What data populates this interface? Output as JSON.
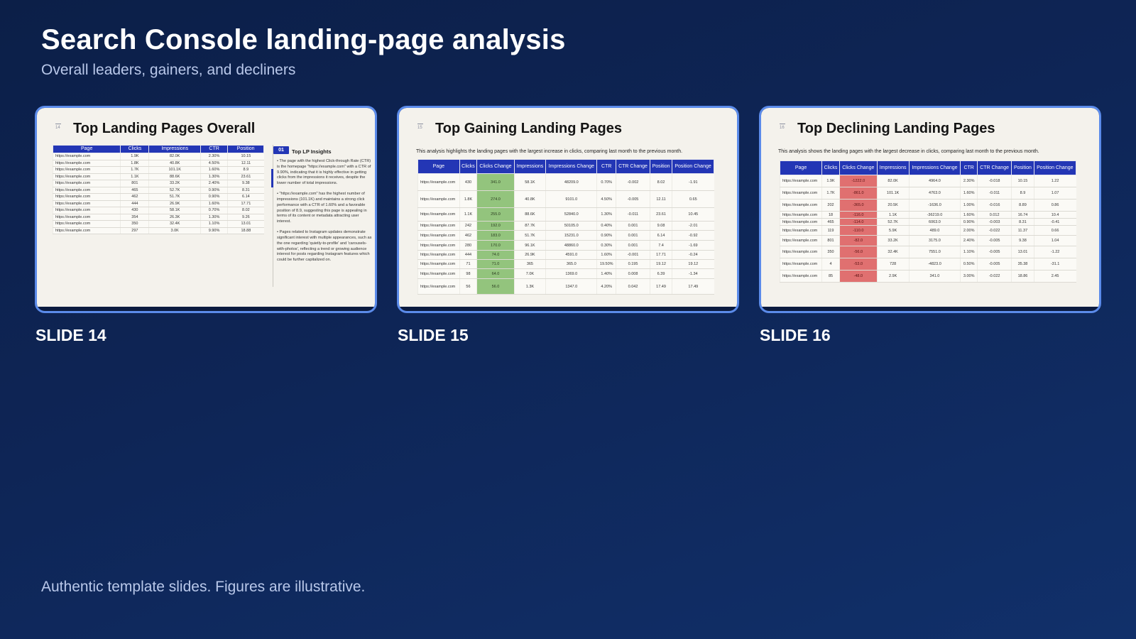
{
  "header": {
    "title": "Search Console landing-page analysis",
    "subtitle": "Overall leaders, gainers, and decliners"
  },
  "footer": {
    "note": "Authentic template slides. Figures are illustrative."
  },
  "colors": {
    "accent": "#2336b5",
    "card_border": "#5b8bea",
    "gain": "#93c47d",
    "loss": "#e07070"
  },
  "slides": [
    {
      "label": "SLIDE 14",
      "number": "14",
      "title": "Top Landing Pages Overall",
      "table": {
        "headers": [
          "Page",
          "Clicks",
          "Impressions",
          "CTR",
          "Position"
        ],
        "rows": [
          [
            "https://example.com",
            "1.9K",
            "82.0K",
            "2.30%",
            "10.15"
          ],
          [
            "https://example.com",
            "1.8K",
            "40.8K",
            "4.50%",
            "12.11"
          ],
          [
            "https://example.com",
            "1.7K",
            "101.1K",
            "1.60%",
            "8.9"
          ],
          [
            "https://example.com",
            "1.1K",
            "88.6K",
            "1.30%",
            "23.61"
          ],
          [
            "https://example.com",
            "801",
            "33.2K",
            "2.40%",
            "9.38"
          ],
          [
            "https://example.com",
            "465",
            "52.7K",
            "0.90%",
            "8.31"
          ],
          [
            "https://example.com",
            "462",
            "51.7K",
            "0.90%",
            "6.14"
          ],
          [
            "https://example.com",
            "444",
            "26.9K",
            "1.60%",
            "17.71"
          ],
          [
            "https://example.com",
            "430",
            "58.1K",
            "0.70%",
            "8.02"
          ],
          [
            "https://example.com",
            "354",
            "26.3K",
            "1.30%",
            "9.26"
          ],
          [
            "https://example.com",
            "350",
            "32.4K",
            "1.10%",
            "13.01"
          ],
          [
            "https://example.com",
            "297",
            "3.0K",
            "9.90%",
            "18.88"
          ]
        ]
      },
      "insights": {
        "badge": "01",
        "title": "Top LP Insights",
        "paragraphs": [
          "• The page with the highest Click-through Rate (CTR) is the homepage \"https://example.com\" with a CTR of 9.90%, indicating that it is highly effective in getting clicks from the impressions it receives, despite the lower number of total impressions.",
          "• \"https://example.com\" has the highest number of impressions (101.1K) and maintains a strong click performance with a CTR of 1.60% and a favorable position of 8.9, suggesting this page is appealing in terms of its content or metadata attracting user interest.",
          "• Pages related to Instagram updates demonstrate significant interest with multiple appearances, such as the one regarding 'quietly-to-profile' and 'carousels-with-photos', reflecting a trend or growing audience interest for posts regarding Instagram features which could be further capitalized on."
        ]
      }
    },
    {
      "label": "SLIDE 15",
      "number": "15",
      "title": "Top Gaining Landing Pages",
      "description": "This analysis highlights the landing pages with the largest increase in clicks, comparing last month to the previous month.",
      "table": {
        "headers": [
          "Page",
          "Clicks",
          "Clicks Change",
          "Impressions",
          "Impressions Change",
          "CTR",
          "CTR Change",
          "Position",
          "Position Change"
        ],
        "rows": [
          [
            "https://example.com",
            "430",
            "341.0",
            "58.1K",
            "48209.0",
            "0.70%",
            "-0.002",
            "8.02",
            "-1.91"
          ],
          [
            "https://example.com",
            "1.8K",
            "274.0",
            "40.8K",
            "9101.0",
            "4.50%",
            "-0.005",
            "12.11",
            "0.65"
          ],
          [
            "https://example.com",
            "1.1K",
            "255.0",
            "88.6K",
            "52840.0",
            "1.30%",
            "-0.011",
            "23.61",
            "10.45"
          ],
          [
            "https://example.com",
            "242",
            "192.0",
            "87.7K",
            "50105.0",
            "0.40%",
            "0.001",
            "9.08",
            "-2.01"
          ],
          [
            "https://example.com",
            "462",
            "183.0",
            "51.7K",
            "15231.0",
            "0.90%",
            "0.001",
            "6.14",
            "-0.92"
          ],
          [
            "https://example.com",
            "280",
            "170.0",
            "96.1K",
            "48860.0",
            "0.30%",
            "0.001",
            "7.4",
            "-1.69"
          ],
          [
            "https://example.com",
            "444",
            "74.0",
            "26.9K",
            "4591.0",
            "1.60%",
            "-0.001",
            "17.71",
            "-0.24"
          ],
          [
            "https://example.com",
            "71",
            "71.0",
            "365",
            "365.0",
            "19.50%",
            "0.195",
            "19.12",
            "19.12"
          ],
          [
            "https://example.com",
            "98",
            "64.0",
            "7.0K",
            "1369.0",
            "1.40%",
            "0.008",
            "6.39",
            "-1.34"
          ],
          [
            "https://example.com",
            "56",
            "56.0",
            "1.3K",
            "1347.0",
            "4.20%",
            "0.042",
            "17.49",
            "17.49"
          ]
        ]
      }
    },
    {
      "label": "SLIDE 16",
      "number": "16",
      "title": "Top Declining Landing Pages",
      "description": "This analysis shows the landing pages with the largest decrease in clicks, comparing last month to the previous month.",
      "table": {
        "headers": [
          "Page",
          "Clicks",
          "Clicks Change",
          "Impressions",
          "Impressions Change",
          "CTR",
          "CTR Change",
          "Position",
          "Position Change"
        ],
        "rows": [
          [
            "https://example.com",
            "1.9K",
            "-1222.0",
            "82.0K",
            "4964.0",
            "2.30%",
            "-0.018",
            "10.15",
            "1.22"
          ],
          [
            "https://example.com",
            "1.7K",
            "-861.0",
            "101.1K",
            "4763.0",
            "1.60%",
            "-0.011",
            "8.9",
            "1.07"
          ],
          [
            "https://example.com",
            "202",
            "-365.0",
            "20.5K",
            "-1636.0",
            "1.00%",
            "-0.016",
            "8.89",
            "0.86"
          ],
          [
            "https://example.com",
            "18",
            "-116.0",
            "1.1K",
            "-36219.0",
            "1.60%",
            "0.012",
            "16.74",
            "10.4"
          ],
          [
            "https://example.com",
            "465",
            "-114.0",
            "52.7K",
            "6063.0",
            "0.90%",
            "-0.003",
            "8.31",
            "-0.41"
          ],
          [
            "https://example.com",
            "119",
            "-110.0",
            "5.9K",
            "489.0",
            "2.00%",
            "-0.022",
            "11.37",
            "0.66"
          ],
          [
            "https://example.com",
            "801",
            "-82.0",
            "33.2K",
            "3175.0",
            "2.40%",
            "-0.005",
            "9.38",
            "1.04"
          ],
          [
            "https://example.com",
            "350",
            "-56.0",
            "32.4K",
            "7551.0",
            "1.10%",
            "-0.005",
            "13.01",
            "-1.22"
          ],
          [
            "https://example.com",
            "4",
            "-53.0",
            "728",
            "-4823.0",
            "0.50%",
            "-0.005",
            "35.38",
            "-31.1"
          ],
          [
            "https://example.com",
            "85",
            "-48.0",
            "2.9K",
            "341.0",
            "3.00%",
            "-0.022",
            "18.86",
            "2.45"
          ]
        ]
      }
    }
  ]
}
